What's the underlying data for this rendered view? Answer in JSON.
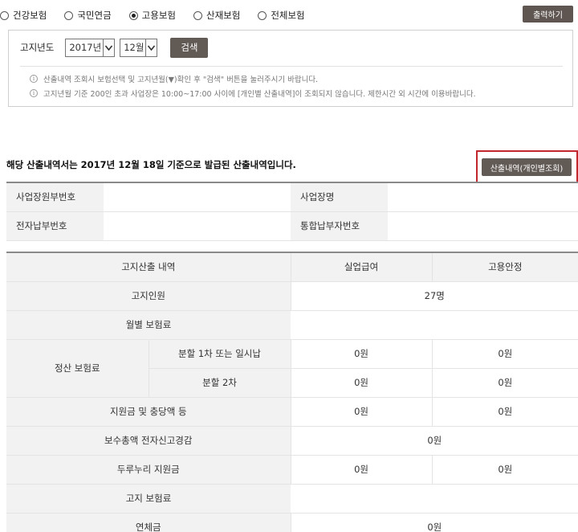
{
  "insurance_types": [
    {
      "label": "건강보험",
      "checked": false
    },
    {
      "label": "국민연금",
      "checked": false
    },
    {
      "label": "고용보험",
      "checked": true
    },
    {
      "label": "산재보험",
      "checked": false
    },
    {
      "label": "전체보험",
      "checked": false
    }
  ],
  "print_button": "출력하기",
  "search": {
    "label": "고지년도",
    "year": "2017년",
    "month": "12월",
    "button": "검색"
  },
  "notices": [
    "산출내역 조회시 보험선택 및 고지년월(▼)확인 후 \"검색\" 버튼을 눌러주시기 바랍니다.",
    "고지년월 기준 200인 초과 사업장은 10:00~17:00 사이에 [개인별 산출내역]이 조회되지 않습니다. 제한시간 외 시간에 이용바랍니다."
  ],
  "issue_title": "해당 산출내역서는 2017년 12월 18일 기준으로 발급된 산출내역입니다.",
  "detail_button": "산출내역(개인별조회)",
  "info": {
    "biz_mgmt_no_label": "사업장원부번호",
    "biz_mgmt_no": "",
    "biz_name_label": "사업장명",
    "biz_name": "",
    "epay_no_label": "전자납부번호",
    "epay_no": "",
    "combined_no_label": "통합납부자번호",
    "combined_no": ""
  },
  "calc": {
    "header": {
      "item": "고지산출 내역",
      "col1": "실업급여",
      "col2": "고용안정"
    },
    "notified_people": {
      "label": "고지인원",
      "value": "27명"
    },
    "monthly_premium": {
      "label": "월별 보험료",
      "col1": "",
      "col2": ""
    },
    "settlement": {
      "label": "정산 보험료",
      "installment1": {
        "label": "분할 1차 또는 일시납",
        "col1": "0원",
        "col2": "0원"
      },
      "installment2": {
        "label": "분할 2차",
        "col1": "0원",
        "col2": "0원"
      }
    },
    "subsidy": {
      "label": "지원금 및 충당액 등",
      "col1": "0원",
      "col2": "0원"
    },
    "report_reduction": {
      "label": "보수총액 전자신고경감",
      "value": "0원"
    },
    "durunuri": {
      "label": "두루누리 지원금",
      "col1": "0원",
      "col2": "0원"
    },
    "notified_premium": {
      "label": "고지 보험료",
      "col1": "",
      "col2": ""
    },
    "late_fee": {
      "label": "연체금",
      "value": "0원"
    }
  }
}
